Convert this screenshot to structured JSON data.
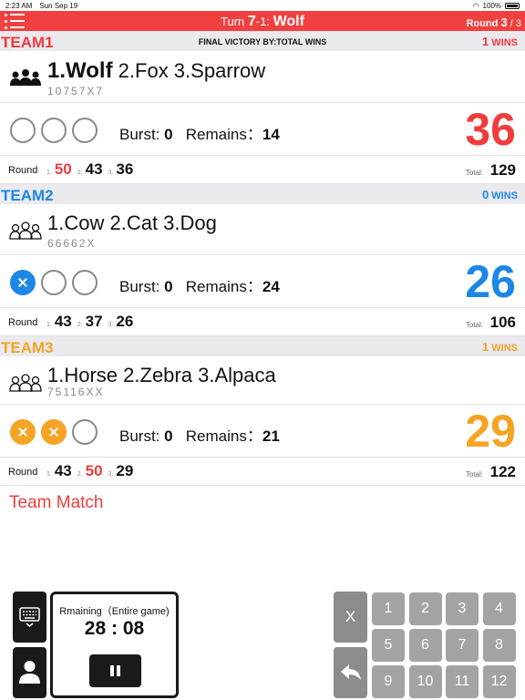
{
  "status": {
    "time": "2:23 AM",
    "date": "Sun Sep 19",
    "battery": "100%"
  },
  "header": {
    "turn_prefix": "Turn ",
    "turn_number": "7",
    "turn_sep": "-1: ",
    "player": "Wolf",
    "round_label": "Round ",
    "round_current": "3",
    "round_total": " / 3",
    "bar_color": "#f04040"
  },
  "final_victory": "FINAL VICTORY BY:TOTAL WINS",
  "teams": [
    {
      "name": "TEAM1",
      "color": "#f03c3c",
      "wins": "1",
      "wins_unit": " WINS",
      "first": "1.Wolf",
      "rest": " 2.Fox 3.Sparrow",
      "order": "10757X7",
      "burst_label": "Burst: ",
      "burst": "0",
      "remains_label": "Remains：",
      "remains": "14",
      "score": "36",
      "round_label": "Round",
      "rounds": [
        {
          "idx": "1.",
          "val": "50"
        },
        {
          "idx": "2.",
          "val": "43"
        },
        {
          "idx": "3.",
          "val": "36"
        }
      ],
      "total_label": "Total:",
      "total": "129"
    },
    {
      "name": "TEAM2",
      "color": "#1c87e6",
      "wins": "0",
      "wins_unit": " WINS",
      "first": "1.Cow",
      "rest": " 2.Cat 3.Dog",
      "order": "66662X",
      "burst_label": "Burst: ",
      "burst": "0",
      "remains_label": "Remains：",
      "remains": "24",
      "score": "26",
      "round_label": "Round",
      "rounds": [
        {
          "idx": "1.",
          "val": "43"
        },
        {
          "idx": "2.",
          "val": "37"
        },
        {
          "idx": "3.",
          "val": "26"
        }
      ],
      "total_label": "Total:",
      "total": "106"
    },
    {
      "name": "TEAM3",
      "color": "#f5a323",
      "wins": "1",
      "wins_unit": " WINS",
      "first": "1.Horse",
      "rest": " 2.Zebra 3.Alpaca",
      "order": "75116XX",
      "burst_label": "Burst: ",
      "burst": "0",
      "remains_label": "Remains：",
      "remains": "21",
      "score": "29",
      "round_label": "Round",
      "rounds": [
        {
          "idx": "1.",
          "val": "43"
        },
        {
          "idx": "2.",
          "val": "50"
        },
        {
          "idx": "3.",
          "val": "29"
        }
      ],
      "total_label": "Total:",
      "total": "122"
    }
  ],
  "team_match": "Team Match",
  "timer": {
    "label": "Rmaining（Entire game)",
    "value": "28 : 08"
  },
  "keypad": {
    "clear": "X",
    "keys": [
      "1",
      "2",
      "3",
      "4",
      "5",
      "6",
      "7",
      "8",
      "9",
      "10",
      "11",
      "12"
    ]
  }
}
